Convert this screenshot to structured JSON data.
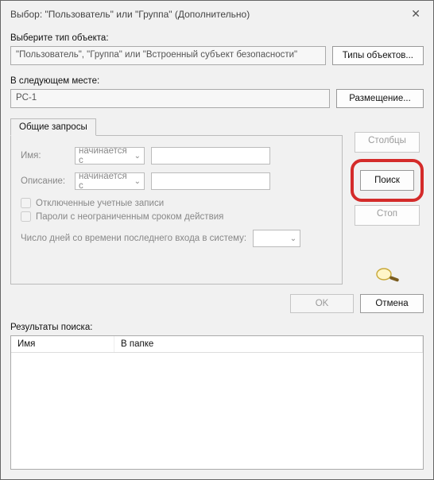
{
  "title": "Выбор: \"Пользователь\" или \"Группа\" (Дополнительно)",
  "label_object_type": "Выберите тип объекта:",
  "object_type_value": "\"Пользователь\", \"Группа\" или \"Встроенный субъект безопасности\"",
  "btn_object_types": "Типы объектов...",
  "label_location": "В следующем месте:",
  "location_value": "PC-1",
  "btn_locations": "Размещение...",
  "tab_label": "Общие запросы",
  "form": {
    "name_label": "Имя:",
    "name_mode": "начинается с",
    "desc_label": "Описание:",
    "desc_mode": "начинается с",
    "chk_disabled": "Отключенные учетные записи",
    "chk_nonexpiring": "Пароли с неограниченным сроком действия",
    "days_label": "Число дней со времени последнего входа в систему:"
  },
  "side": {
    "columns": "Столбцы",
    "search": "Поиск",
    "stop": "Стоп"
  },
  "footer": {
    "ok": "OK",
    "cancel": "Отмена"
  },
  "results_label": "Результаты поиска:",
  "results_cols": {
    "name": "Имя",
    "folder": "В папке"
  }
}
